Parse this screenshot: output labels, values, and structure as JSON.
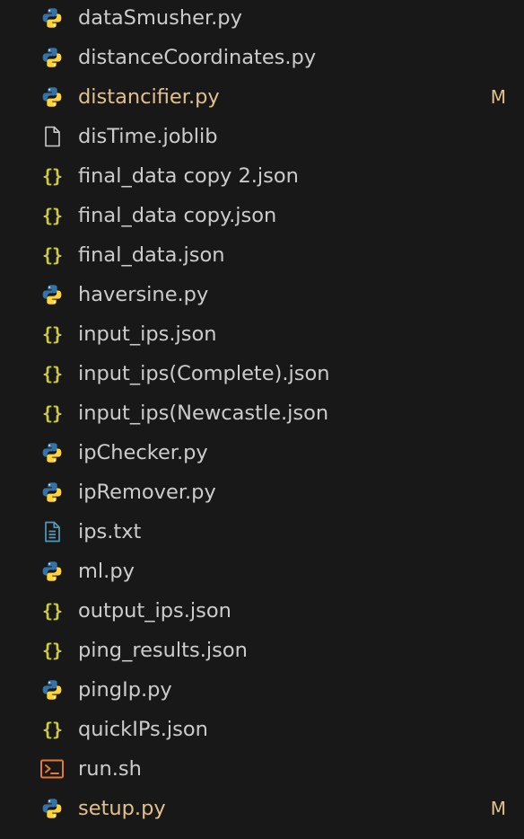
{
  "colors": {
    "background": "#181818",
    "text": "#cccccc",
    "modified": "#e2c08d",
    "json_icon": "#cbcb41",
    "python_blue": "#3572A5",
    "python_yellow": "#FFD43B",
    "text_file_icon": "#519aba",
    "shell_icon": "#e37933"
  },
  "files": [
    {
      "name": "dataSmusher.py",
      "icon": "python-icon",
      "badge": ""
    },
    {
      "name": "distanceCoordinates.py",
      "icon": "python-icon",
      "badge": ""
    },
    {
      "name": "distancifier.py",
      "icon": "python-icon",
      "badge": "M"
    },
    {
      "name": "disTime.joblib",
      "icon": "file-icon",
      "badge": ""
    },
    {
      "name": "final_data copy 2.json",
      "icon": "json-icon",
      "badge": ""
    },
    {
      "name": "final_data copy.json",
      "icon": "json-icon",
      "badge": ""
    },
    {
      "name": "final_data.json",
      "icon": "json-icon",
      "badge": ""
    },
    {
      "name": "haversine.py",
      "icon": "python-icon",
      "badge": ""
    },
    {
      "name": "input_ips.json",
      "icon": "json-icon",
      "badge": ""
    },
    {
      "name": "input_ips(Complete).json",
      "icon": "json-icon",
      "badge": ""
    },
    {
      "name": "input_ips(Newcastle.json",
      "icon": "json-icon",
      "badge": ""
    },
    {
      "name": "ipChecker.py",
      "icon": "python-icon",
      "badge": ""
    },
    {
      "name": "ipRemover.py",
      "icon": "python-icon",
      "badge": ""
    },
    {
      "name": "ips.txt",
      "icon": "text-file-icon",
      "badge": ""
    },
    {
      "name": "ml.py",
      "icon": "python-icon",
      "badge": ""
    },
    {
      "name": "output_ips.json",
      "icon": "json-icon",
      "badge": ""
    },
    {
      "name": "ping_results.json",
      "icon": "json-icon",
      "badge": ""
    },
    {
      "name": "pingIp.py",
      "icon": "python-icon",
      "badge": ""
    },
    {
      "name": "quickIPs.json",
      "icon": "json-icon",
      "badge": ""
    },
    {
      "name": "run.sh",
      "icon": "shell-icon",
      "badge": ""
    },
    {
      "name": "setup.py",
      "icon": "python-icon",
      "badge": "M"
    }
  ]
}
